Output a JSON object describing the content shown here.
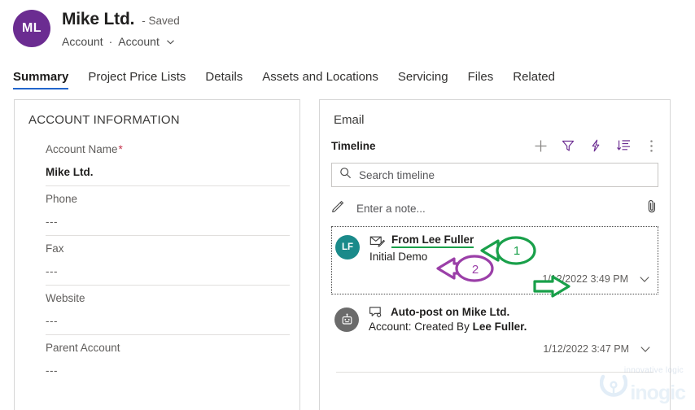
{
  "header": {
    "avatar_initials": "ML",
    "record_title": "Mike Ltd.",
    "save_state": "- Saved",
    "breadcrumb_entity": "Account",
    "breadcrumb_sep": "·",
    "breadcrumb_form": "Account",
    "avatar_color": "#6b2c91",
    "chevron_icon": "chevron-down-icon"
  },
  "tabs": [
    {
      "label": "Summary",
      "active": true
    },
    {
      "label": "Project Price Lists",
      "active": false
    },
    {
      "label": "Details",
      "active": false
    },
    {
      "label": "Assets and Locations",
      "active": false
    },
    {
      "label": "Servicing",
      "active": false
    },
    {
      "label": "Files",
      "active": false
    },
    {
      "label": "Related",
      "active": false
    }
  ],
  "account_card": {
    "section_title": "ACCOUNT INFORMATION",
    "fields": [
      {
        "label": "Account Name",
        "required": true,
        "value": "Mike Ltd.",
        "strong": true
      },
      {
        "label": "Phone",
        "required": false,
        "value": "---",
        "strong": false
      },
      {
        "label": "Fax",
        "required": false,
        "value": "---",
        "strong": false
      },
      {
        "label": "Website",
        "required": false,
        "value": "---",
        "strong": false
      },
      {
        "label": "Parent Account",
        "required": false,
        "value": "---",
        "strong": false
      }
    ]
  },
  "email_panel": {
    "panel_title": "Email",
    "timeline_label": "Timeline",
    "toolbar": [
      {
        "name": "add-icon",
        "color": "#868686"
      },
      {
        "name": "filter-icon",
        "color": "#6b2c91"
      },
      {
        "name": "flow-icon",
        "color": "#6b2c91"
      },
      {
        "name": "sort-icon",
        "color": "#6b2c91"
      },
      {
        "name": "more-vertical-icon",
        "color": "#868686"
      }
    ],
    "search": {
      "placeholder": "Search timeline",
      "icon": "search-icon"
    },
    "note": {
      "placeholder": "Enter a note...",
      "icon": "pencil-icon",
      "attach_icon": "attachment-icon"
    },
    "items": [
      {
        "avatar_initials": "LF",
        "avatar_color": "#1a8a8a",
        "type_icon": "email-icon",
        "headline": "From Lee Fuller",
        "subject": "Initial Demo",
        "subject_bold": "",
        "date": "1/12/2022 3:49 PM",
        "focused": true,
        "underlined": true
      },
      {
        "avatar_initials": "",
        "avatar_color": "#6b6b6b",
        "type_icon": "auto-post-icon",
        "headline": "Auto-post on Mike Ltd.",
        "subject": "Account: Created By ",
        "subject_bold": "Lee Fuller.",
        "date": "1/12/2022 3:47 PM",
        "focused": false,
        "underlined": false
      }
    ]
  },
  "annotations": [
    {
      "id": "1",
      "color": "#19a04a",
      "direction": "left",
      "target": "From Lee Fuller"
    },
    {
      "id": "2",
      "color": "#9b3fa8",
      "direction": "left",
      "target": "Initial Demo"
    },
    {
      "id": "",
      "color": "#19a04a",
      "direction": "right",
      "target": "1/12/2022 3:49 PM"
    }
  ],
  "watermark": {
    "tagline": "innovative logic",
    "brand": "inogic"
  }
}
